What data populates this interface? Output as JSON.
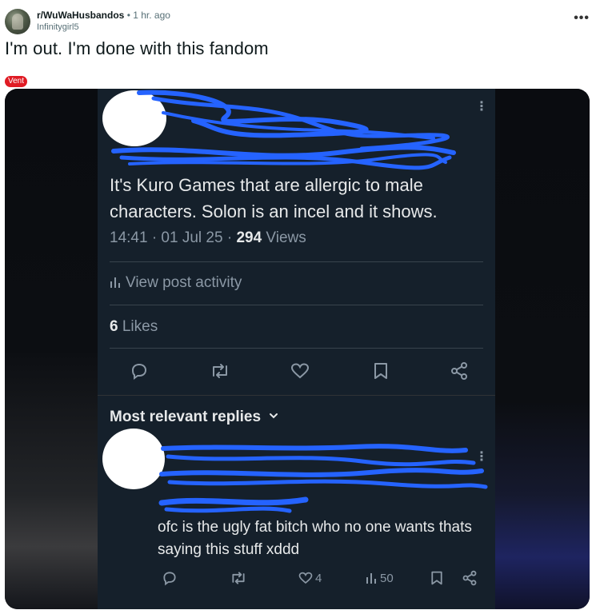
{
  "post": {
    "subreddit": "r/WuWaHusbandos",
    "separator": "•",
    "time_ago": "1 hr. ago",
    "author": "Infinitygirl5",
    "more_label": "•••",
    "title": "I'm out. I'm done with this fandom",
    "flair": "Vent"
  },
  "tweet": {
    "text": "It's Kuro Games that are allergic to male characters. Solon is an incel and it shows.",
    "time": "14:41 · 01 Jul 25 · ",
    "views_count": "294",
    "views_label": " Views",
    "activity_label": "View post activity",
    "likes_count": "6",
    "likes_label": " Likes"
  },
  "replies": {
    "header": "Most relevant replies",
    "reply": {
      "text": "ofc is the ugly fat bitch who no one wants thats saying this stuff xddd",
      "likes": "4",
      "views": "50"
    }
  },
  "colors": {
    "twitter_bg": "#15202b",
    "redaction": "#2563ff",
    "flair": "#e01b24"
  }
}
